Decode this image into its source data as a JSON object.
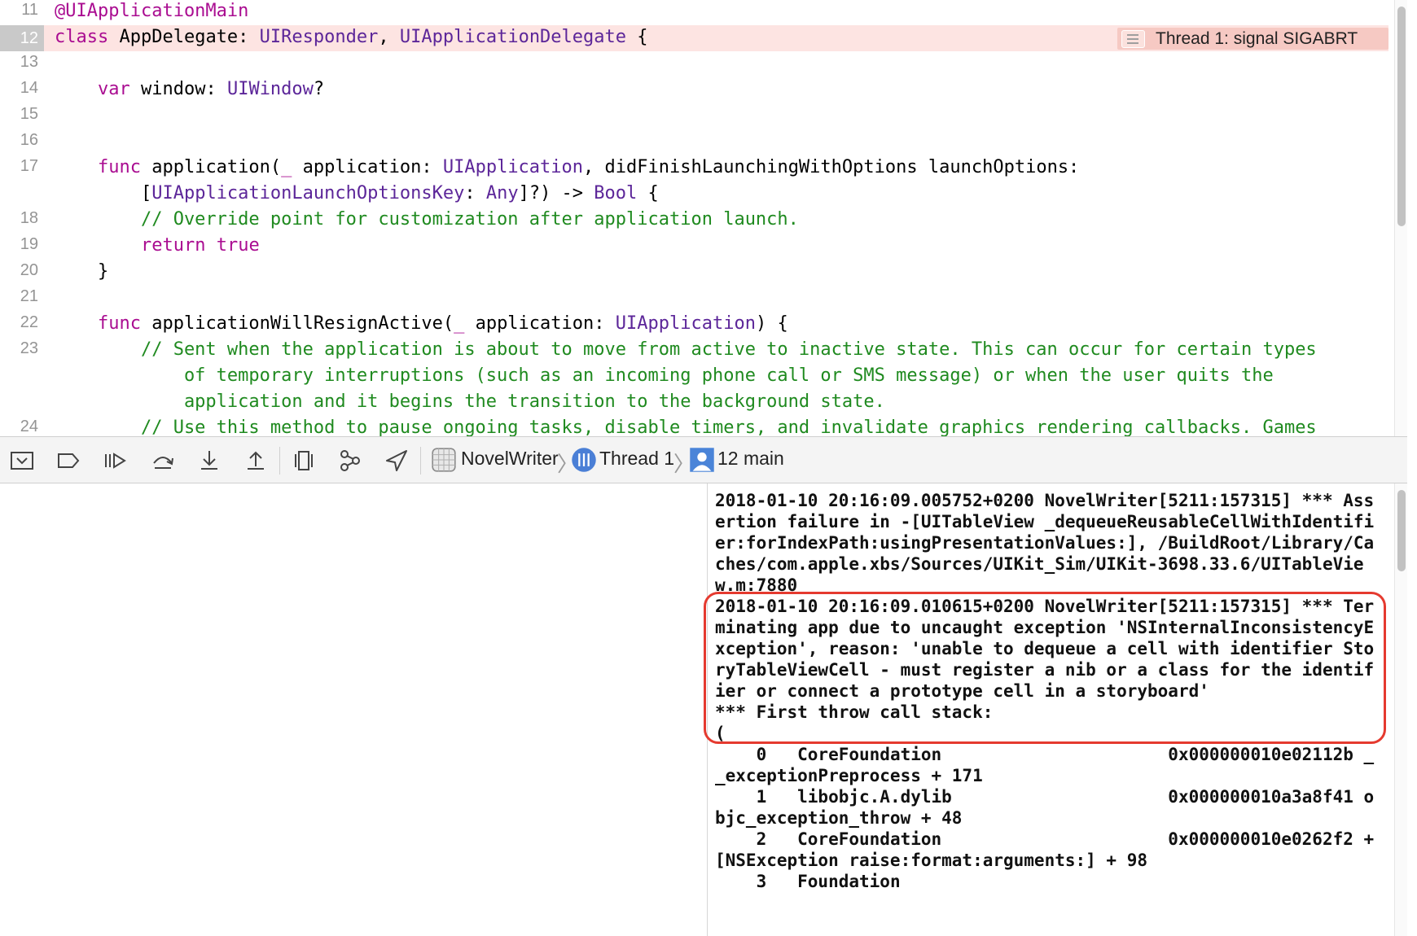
{
  "editor": {
    "lines": [
      {
        "num": "11",
        "tokens": [
          {
            "t": "@UIApplicationMain",
            "c": "at"
          }
        ]
      },
      {
        "num": "12",
        "tokens": [
          {
            "t": "class",
            "c": "kw"
          },
          {
            "t": " AppDelegate: ",
            "c": ""
          },
          {
            "t": "UIResponder",
            "c": "ty"
          },
          {
            "t": ", ",
            "c": ""
          },
          {
            "t": "UIApplicationDelegate",
            "c": "ty"
          },
          {
            "t": " {",
            "c": ""
          }
        ],
        "highlight": true
      },
      {
        "num": "13",
        "tokens": []
      },
      {
        "num": "14",
        "tokens": [
          {
            "t": "    ",
            "c": ""
          },
          {
            "t": "var",
            "c": "kw"
          },
          {
            "t": " window: ",
            "c": ""
          },
          {
            "t": "UIWindow",
            "c": "ty"
          },
          {
            "t": "?",
            "c": ""
          }
        ]
      },
      {
        "num": "15",
        "tokens": []
      },
      {
        "num": "16",
        "tokens": []
      },
      {
        "num": "17",
        "tokens": [
          {
            "t": "    ",
            "c": ""
          },
          {
            "t": "func",
            "c": "kw"
          },
          {
            "t": " application(",
            "c": ""
          },
          {
            "t": "_",
            "c": "kw"
          },
          {
            "t": " application: ",
            "c": ""
          },
          {
            "t": "UIApplication",
            "c": "ty"
          },
          {
            "t": ", didFinishLaunchingWithOptions launchOptions:",
            "c": ""
          }
        ]
      },
      {
        "num": "",
        "tokens": [
          {
            "t": "        [",
            "c": ""
          },
          {
            "t": "UIApplicationLaunchOptionsKey",
            "c": "ty"
          },
          {
            "t": ": ",
            "c": ""
          },
          {
            "t": "Any",
            "c": "ty"
          },
          {
            "t": "]?) -> ",
            "c": ""
          },
          {
            "t": "Bool",
            "c": "ty"
          },
          {
            "t": " {",
            "c": ""
          }
        ]
      },
      {
        "num": "18",
        "tokens": [
          {
            "t": "        // Override point for customization after application launch.",
            "c": "cm"
          }
        ]
      },
      {
        "num": "19",
        "tokens": [
          {
            "t": "        ",
            "c": ""
          },
          {
            "t": "return",
            "c": "kw"
          },
          {
            "t": " ",
            "c": ""
          },
          {
            "t": "true",
            "c": "kw"
          }
        ]
      },
      {
        "num": "20",
        "tokens": [
          {
            "t": "    }",
            "c": ""
          }
        ]
      },
      {
        "num": "21",
        "tokens": []
      },
      {
        "num": "22",
        "tokens": [
          {
            "t": "    ",
            "c": ""
          },
          {
            "t": "func",
            "c": "kw"
          },
          {
            "t": " applicationWillResignActive(",
            "c": ""
          },
          {
            "t": "_",
            "c": "kw"
          },
          {
            "t": " application: ",
            "c": ""
          },
          {
            "t": "UIApplication",
            "c": "ty"
          },
          {
            "t": ") {",
            "c": ""
          }
        ]
      },
      {
        "num": "23",
        "tokens": [
          {
            "t": "        // Sent when the application is about to move from active to inactive state. This can occur for certain types",
            "c": "cm"
          }
        ]
      },
      {
        "num": "",
        "tokens": [
          {
            "t": "            of temporary interruptions (such as an incoming phone call or SMS message) or when the user quits the",
            "c": "cm"
          }
        ]
      },
      {
        "num": "",
        "tokens": [
          {
            "t": "            application and it begins the transition to the background state.",
            "c": "cm"
          }
        ]
      },
      {
        "num": "24",
        "tokens": [
          {
            "t": "        // Use this method to pause ongoing tasks, disable timers, and invalidate graphics rendering callbacks. Games",
            "c": "cm"
          }
        ]
      }
    ],
    "issue_badge": "Thread 1: signal SIGABRT"
  },
  "debug_bar": {
    "buttons": [
      "hide-debug-area",
      "breakpoints-toggle",
      "continue",
      "step-over",
      "step-into",
      "step-out",
      "debug-view-hierarchy",
      "memory-graph",
      "simulate-location"
    ],
    "breadcrumb": [
      "NovelWriter",
      "Thread 1",
      "12 main"
    ]
  },
  "console": {
    "text": "2018-01-10 20:16:09.005752+0200 NovelWriter[5211:157315] *** Assertion failure in -[UITableView _dequeueReusableCellWithIdentifier:forIndexPath:usingPresentationValues:], /BuildRoot/Library/Caches/com.apple.xbs/Sources/UIKit_Sim/UIKit-3698.33.6/UITableView.m:7880\n2018-01-10 20:16:09.010615+0200 NovelWriter[5211:157315] *** Terminating app due to uncaught exception 'NSInternalInconsistencyException', reason: 'unable to dequeue a cell with identifier StoryTableViewCell - must register a nib or a class for the identifier or connect a prototype cell in a storyboard'\n*** First throw call stack:\n(\n    0   CoreFoundation                      0x000000010e02112b __exceptionPreprocess + 171\n    1   libobjc.A.dylib                     0x000000010a3a8f41 objc_exception_throw + 48\n    2   CoreFoundation                      0x000000010e0262f2 +[NSException raise:format:arguments:] + 98\n    3   Foundation"
  }
}
